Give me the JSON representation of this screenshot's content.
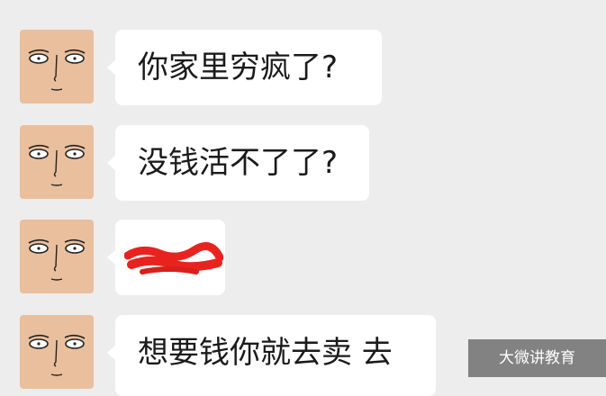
{
  "chat": {
    "messages": [
      {
        "text": "你家里穷疯了?"
      },
      {
        "text": "没钱活不了了?"
      },
      {
        "text": "",
        "redacted": true
      },
      {
        "text": "想要钱你就去卖 去"
      }
    ]
  },
  "watermark": {
    "text": "大微讲教育"
  },
  "colors": {
    "background": "#ededed",
    "bubble": "#ffffff",
    "avatar": "#e9bf9d",
    "scribble": "#e8231f"
  }
}
